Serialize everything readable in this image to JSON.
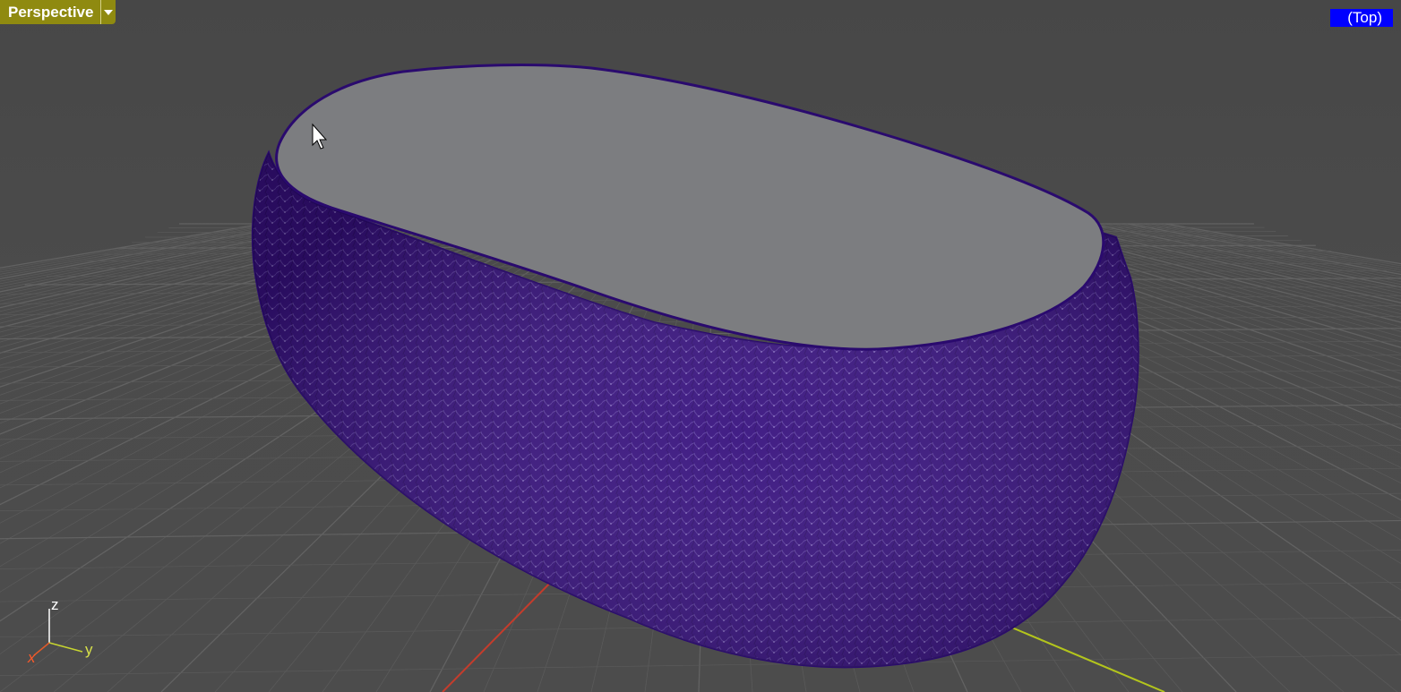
{
  "viewport": {
    "title": "Perspective",
    "view_label": "(Top)"
  },
  "axes": {
    "z_label": "z",
    "y_label": "y",
    "x_label": "x"
  },
  "colors": {
    "background": "#4a4a4a",
    "grid_minor": "#5a5a5a",
    "grid_major": "#626262",
    "mesh": "#36107e",
    "top_face": "#7c7d80",
    "x_axis": "#c43c2c",
    "y_axis": "#b3c51c",
    "view_badge": "#0000ff",
    "tab": "#8f8a10"
  },
  "icons": {
    "cursor": "arrow-cursor-icon",
    "dropdown": "chevron-down-icon"
  }
}
